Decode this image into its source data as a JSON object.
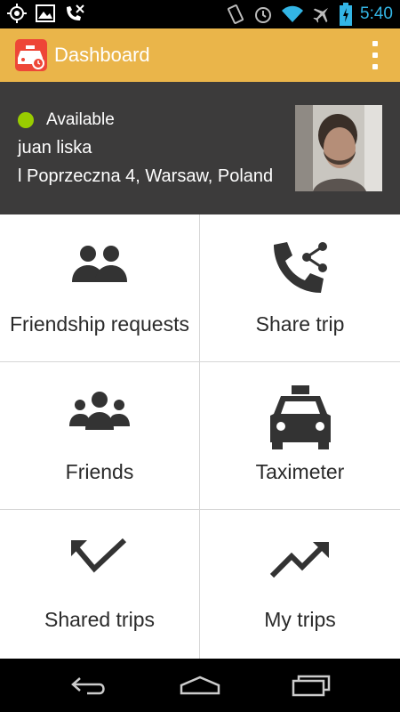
{
  "status_bar": {
    "time": "5:40",
    "left_icons": [
      "gps-icon",
      "photo-icon",
      "missed-call-icon"
    ],
    "right_icons": [
      "vibrate-icon",
      "alarm-icon",
      "wifi-icon",
      "airplane-icon",
      "battery-icon"
    ],
    "clock_color": "#33b5e5"
  },
  "action_bar": {
    "title": "Dashboard",
    "app_icon": "taxi-app-icon",
    "menu_icon": "overflow-menu-icon",
    "background": "#eab54a"
  },
  "profile": {
    "status": "Available",
    "status_color": "#99cc00",
    "name": "juan liska",
    "address": "l Poprzeczna 4, Warsaw, Poland",
    "avatar": "user-avatar-photo"
  },
  "tiles": [
    {
      "label": "Friendship requests",
      "icon": "friend-requests-icon"
    },
    {
      "label": "Share trip",
      "icon": "share-trip-icon"
    },
    {
      "label": "Friends",
      "icon": "friends-icon"
    },
    {
      "label": "Taximeter",
      "icon": "taxi-icon"
    },
    {
      "label": "Shared trips",
      "icon": "shared-trips-icon"
    },
    {
      "label": "My trips",
      "icon": "my-trips-icon"
    }
  ],
  "nav_bar": {
    "buttons": [
      "back-icon",
      "home-icon",
      "recent-apps-icon"
    ]
  }
}
